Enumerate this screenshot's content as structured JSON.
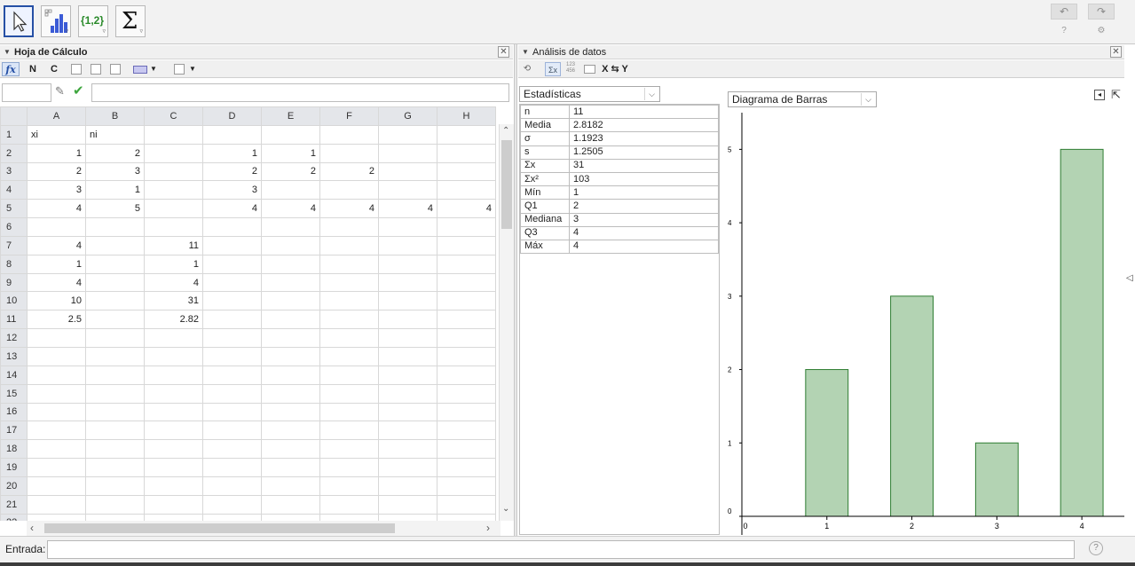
{
  "toolbar": {
    "tools": [
      {
        "name": "move-tool",
        "label": ""
      },
      {
        "name": "bar-chart-tool",
        "label": ""
      },
      {
        "name": "list-tool",
        "label": "{1,2}"
      },
      {
        "name": "sum-tool",
        "label": "Σ"
      }
    ],
    "undo": "↶",
    "redo": "↷",
    "help": "?",
    "settings": "⚙"
  },
  "spreadsheet": {
    "title": "Hoja de Cálculo",
    "fx": "fx",
    "bold": "N",
    "italic": "C",
    "columns": [
      "A",
      "B",
      "C",
      "D",
      "E",
      "F",
      "G",
      "H"
    ],
    "rows": [
      [
        "xi",
        "ni",
        "",
        "",
        "",
        "",
        "",
        ""
      ],
      [
        "1",
        "2",
        "",
        "1",
        "1",
        "",
        "",
        ""
      ],
      [
        "2",
        "3",
        "",
        "2",
        "2",
        "2",
        "",
        ""
      ],
      [
        "3",
        "1",
        "",
        "3",
        "",
        "",
        "",
        ""
      ],
      [
        "4",
        "5",
        "",
        "4",
        "4",
        "4",
        "4",
        "4"
      ],
      [
        "",
        "",
        "",
        "",
        "",
        "",
        "",
        ""
      ],
      [
        "4",
        "",
        "11",
        "",
        "",
        "",
        "",
        ""
      ],
      [
        "1",
        "",
        "1",
        "",
        "",
        "",
        "",
        ""
      ],
      [
        "4",
        "",
        "4",
        "",
        "",
        "",
        "",
        ""
      ],
      [
        "10",
        "",
        "31",
        "",
        "",
        "",
        "",
        ""
      ],
      [
        "2.5",
        "",
        "2.82",
        "",
        "",
        "",
        "",
        ""
      ],
      [
        "",
        "",
        "",
        "",
        "",
        "",
        "",
        ""
      ],
      [
        "",
        "",
        "",
        "",
        "",
        "",
        "",
        ""
      ],
      [
        "",
        "",
        "",
        "",
        "",
        "",
        "",
        ""
      ],
      [
        "",
        "",
        "",
        "",
        "",
        "",
        "",
        ""
      ],
      [
        "",
        "",
        "",
        "",
        "",
        "",
        "",
        ""
      ],
      [
        "",
        "",
        "",
        "",
        "",
        "",
        "",
        ""
      ],
      [
        "",
        "",
        "",
        "",
        "",
        "",
        "",
        ""
      ],
      [
        "",
        "",
        "",
        "",
        "",
        "",
        "",
        ""
      ],
      [
        "",
        "",
        "",
        "",
        "",
        "",
        "",
        ""
      ],
      [
        "",
        "",
        "",
        "",
        "",
        "",
        "",
        ""
      ],
      [
        "",
        "",
        "",
        "",
        "",
        "",
        "",
        ""
      ]
    ]
  },
  "analysis": {
    "title": "Análisis de datos",
    "swap_label": "X ⇆ Y",
    "mode_select": "Estadísticas",
    "stats": [
      {
        "k": "n",
        "v": "11"
      },
      {
        "k": "Media",
        "v": "2.8182"
      },
      {
        "k": "σ",
        "v": "1.1923"
      },
      {
        "k": "s",
        "v": "1.2505"
      },
      {
        "k": "Σx",
        "v": "31"
      },
      {
        "k": "Σx²",
        "v": "103"
      },
      {
        "k": "Mín",
        "v": "1"
      },
      {
        "k": "Q1",
        "v": "2"
      },
      {
        "k": "Mediana",
        "v": "3"
      },
      {
        "k": "Q3",
        "v": "4"
      },
      {
        "k": "Máx",
        "v": "4"
      }
    ],
    "chart_select": "Diagrama de Barras"
  },
  "chart_data": {
    "type": "bar",
    "categories": [
      "1",
      "2",
      "3",
      "4"
    ],
    "values": [
      2,
      3,
      1,
      5
    ],
    "x_ticks": [
      "0",
      "1",
      "2",
      "3",
      "4"
    ],
    "y_ticks": [
      "0",
      "1",
      "2",
      "3",
      "4",
      "5"
    ],
    "xlim": [
      0,
      4.5
    ],
    "ylim": [
      0,
      5.5
    ],
    "bar_color": "#b3d3b3",
    "bar_stroke": "#2e7d32",
    "grid": false
  },
  "inputbar": {
    "label": "Entrada:",
    "value": "",
    "help": "?"
  },
  "colors": {
    "accent": "#2650a5",
    "check": "#3ea63e"
  }
}
